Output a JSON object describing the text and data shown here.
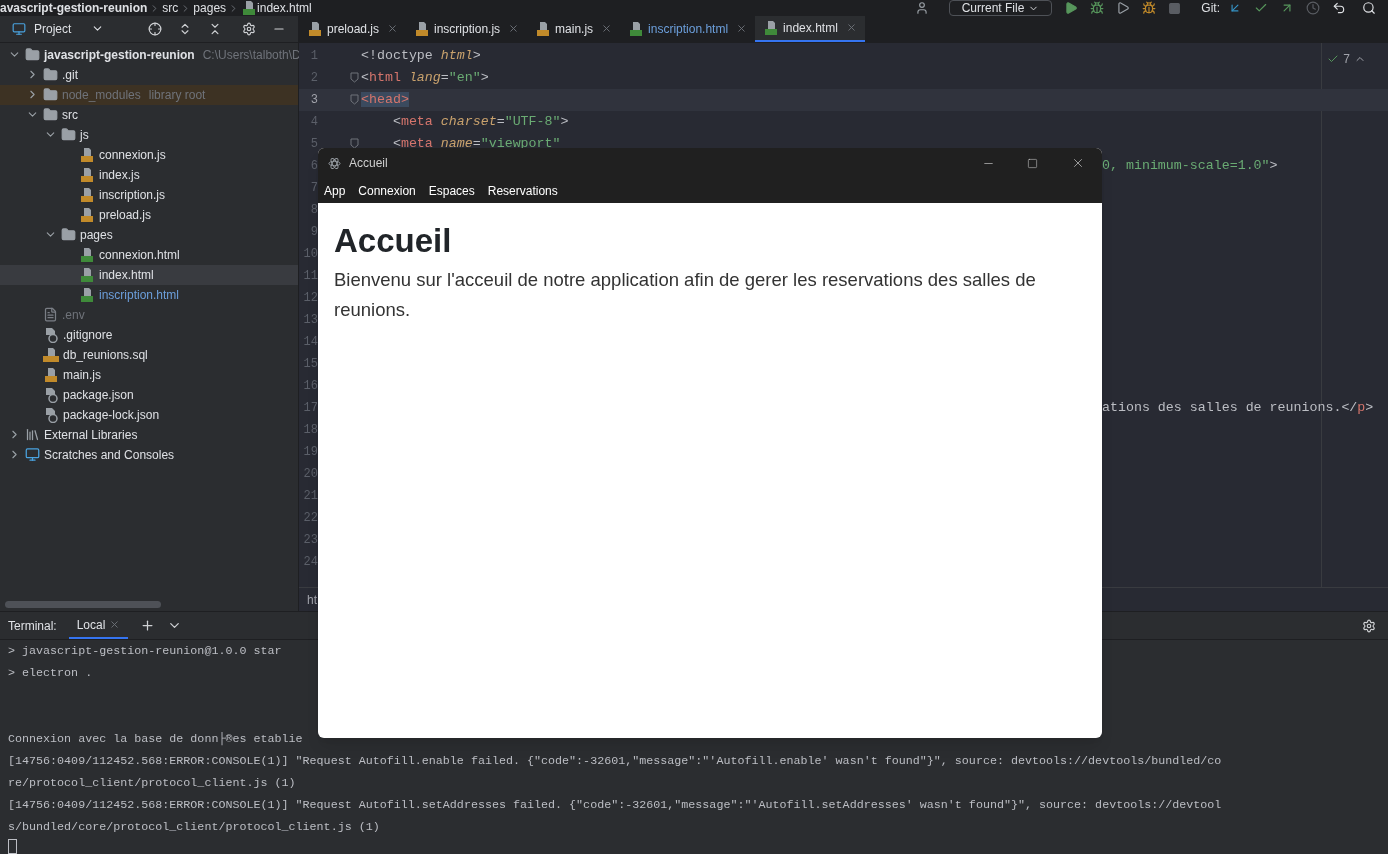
{
  "breadcrumb": [
    "avascript-gestion-reunion",
    "src",
    "pages",
    "index.html"
  ],
  "toolbar": {
    "run_config": "Current File",
    "git_label": "Git:"
  },
  "project_panel": {
    "title": "Project"
  },
  "tree": [
    {
      "label": "javascript-gestion-reunion",
      "hint": "C:\\Users\\talboth\\D",
      "kind": "folder",
      "expanded": true,
      "selected": false,
      "modified": false,
      "dimmed": false,
      "children": [
        {
          "label": ".git",
          "kind": "folder",
          "expanded": false,
          "selected": false,
          "modified": false,
          "dimmed": false,
          "excluded": false
        },
        {
          "label": "node_modules",
          "hint": "library root",
          "kind": "folder",
          "expanded": false,
          "selected": false,
          "modified": false,
          "dimmed": true,
          "excluded": true
        },
        {
          "label": "src",
          "kind": "folder",
          "expanded": true,
          "selected": false,
          "modified": false,
          "dimmed": false,
          "excluded": false,
          "children": [
            {
              "label": "js",
              "kind": "folder",
              "expanded": true,
              "selected": false,
              "modified": false,
              "dimmed": false,
              "children": [
                {
                  "label": "connexion.js",
                  "kind": "js",
                  "selected": false,
                  "modified": false,
                  "dimmed": false
                },
                {
                  "label": "index.js",
                  "kind": "js",
                  "selected": false,
                  "modified": false,
                  "dimmed": false
                },
                {
                  "label": "inscription.js",
                  "kind": "js",
                  "selected": false,
                  "modified": false,
                  "dimmed": false
                },
                {
                  "label": "preload.js",
                  "kind": "js",
                  "selected": false,
                  "modified": false,
                  "dimmed": false
                }
              ]
            },
            {
              "label": "pages",
              "kind": "folder",
              "expanded": true,
              "selected": false,
              "modified": false,
              "dimmed": false,
              "children": [
                {
                  "label": "connexion.html",
                  "kind": "html",
                  "selected": false,
                  "modified": false,
                  "dimmed": false
                },
                {
                  "label": "index.html",
                  "kind": "html",
                  "selected": true,
                  "modified": false,
                  "dimmed": false
                },
                {
                  "label": "inscription.html",
                  "kind": "html",
                  "selected": false,
                  "modified": true,
                  "dimmed": false
                }
              ]
            }
          ]
        },
        {
          "label": ".env",
          "kind": "text",
          "selected": false,
          "modified": false,
          "dimmed": true,
          "excluded": false
        },
        {
          "label": ".gitignore",
          "kind": "ignorefile",
          "selected": false,
          "modified": false,
          "dimmed": false,
          "excluded": false
        },
        {
          "label": "db_reunions.sql",
          "kind": "sql",
          "selected": false,
          "modified": false,
          "dimmed": false,
          "excluded": false
        },
        {
          "label": "main.js",
          "kind": "js",
          "selected": false,
          "modified": false,
          "dimmed": false,
          "excluded": false
        },
        {
          "label": "package.json",
          "kind": "json",
          "selected": false,
          "modified": false,
          "dimmed": false,
          "excluded": false
        },
        {
          "label": "package-lock.json",
          "kind": "json",
          "selected": false,
          "modified": false,
          "dimmed": false,
          "excluded": false
        }
      ]
    },
    {
      "label": "External Libraries",
      "kind": "libraries",
      "expanded": false,
      "selected": false,
      "modified": false,
      "dimmed": false
    },
    {
      "label": "Scratches and Consoles",
      "kind": "scratches",
      "expanded": false,
      "selected": false,
      "modified": false,
      "dimmed": false
    }
  ],
  "tabs": [
    {
      "label": "preload.js",
      "kind": "js",
      "selected": false,
      "modified": false
    },
    {
      "label": "inscription.js",
      "kind": "js",
      "selected": false,
      "modified": false
    },
    {
      "label": "main.js",
      "kind": "js",
      "selected": false,
      "modified": false
    },
    {
      "label": "inscription.html",
      "kind": "html",
      "selected": false,
      "modified": true
    },
    {
      "label": "index.html",
      "kind": "html",
      "selected": true,
      "modified": false
    }
  ],
  "editor": {
    "inspection_count": "7",
    "status_path": "ht",
    "lines": [
      {
        "number": "1",
        "fold": false,
        "current": false,
        "code": [
          {
            "text": "<!doctype ",
            "kind": "plain"
          },
          {
            "text": "html",
            "kind": "attr"
          },
          {
            "text": ">",
            "kind": "plain"
          }
        ]
      },
      {
        "number": "2",
        "fold": true,
        "current": false,
        "code": [
          {
            "text": "<",
            "kind": "plain"
          },
          {
            "text": "html",
            "kind": "tag"
          },
          {
            "text": " lang",
            "kind": "attr"
          },
          {
            "text": "=",
            "kind": "plain"
          },
          {
            "text": "\"en\"",
            "kind": "value"
          },
          {
            "text": ">",
            "kind": "plain"
          }
        ]
      },
      {
        "number": "3",
        "fold": true,
        "current": true,
        "code": [
          {
            "text": "<head>",
            "kind": "selected-tag"
          }
        ]
      },
      {
        "number": "4",
        "fold": false,
        "current": false,
        "code": [
          {
            "text": "    <",
            "kind": "plain"
          },
          {
            "text": "meta",
            "kind": "tag"
          },
          {
            "text": " charset",
            "kind": "attr"
          },
          {
            "text": "=",
            "kind": "plain"
          },
          {
            "text": "\"UTF-8\"",
            "kind": "value"
          },
          {
            "text": ">",
            "kind": "plain"
          }
        ]
      },
      {
        "number": "5",
        "fold": true,
        "current": false,
        "code": [
          {
            "text": "    <",
            "kind": "plain"
          },
          {
            "text": "meta",
            "kind": "tag"
          },
          {
            "text": " name",
            "kind": "attr"
          },
          {
            "text": "=",
            "kind": "plain"
          },
          {
            "text": "\"viewport\"",
            "kind": "value"
          }
        ]
      },
      {
        "number": "6",
        "fold": false,
        "current": false,
        "tail": [
          {
            "text": "0, minimum-scale=1.0\"",
            "kind": "value"
          },
          {
            "text": ">",
            "kind": "plain"
          }
        ]
      },
      {
        "number": "7",
        "fold": false,
        "current": false
      },
      {
        "number": "8",
        "fold": false,
        "current": false
      },
      {
        "number": "9",
        "fold": false,
        "current": false
      },
      {
        "number": "10",
        "fold": false,
        "current": false
      },
      {
        "number": "11",
        "fold": false,
        "current": false
      },
      {
        "number": "12",
        "fold": false,
        "current": false
      },
      {
        "number": "13",
        "fold": false,
        "current": false
      },
      {
        "number": "14",
        "fold": false,
        "current": false
      },
      {
        "number": "15",
        "fold": false,
        "current": false
      },
      {
        "number": "16",
        "fold": false,
        "current": false
      },
      {
        "number": "17",
        "fold": false,
        "current": false,
        "tail": [
          {
            "text": "ations des salles de reunions.</",
            "kind": "plain"
          },
          {
            "text": "p",
            "kind": "tag"
          },
          {
            "text": ">",
            "kind": "plain"
          }
        ]
      },
      {
        "number": "18",
        "fold": false,
        "current": false
      },
      {
        "number": "19",
        "fold": false,
        "current": false
      },
      {
        "number": "20",
        "fold": false,
        "current": false
      },
      {
        "number": "21",
        "fold": false,
        "current": false
      },
      {
        "number": "22",
        "fold": false,
        "current": false
      },
      {
        "number": "23",
        "fold": false,
        "current": false
      },
      {
        "number": "24",
        "fold": false,
        "current": false
      }
    ]
  },
  "terminal": {
    "title": "Terminal:",
    "tabs": [
      {
        "label": "Local",
        "selected": true
      }
    ],
    "blocks": [
      [
        "> javascript-gestion-reunion@1.0.0 star",
        "> electron ."
      ],
      [
        "Connexion avec la base de donn├®es etablie",
        "[14756:0409/112452.568:ERROR:CONSOLE(1)] \"Request Autofill.enable failed. {\"code\":-32601,\"message\":\"'Autofill.enable' wasn't found\"}\", source: devtools://devtools/bundled/co",
        "re/protocol_client/protocol_client.js (1)",
        "[14756:0409/112452.568:ERROR:CONSOLE(1)] \"Request Autofill.setAddresses failed. {\"code\":-32601,\"message\":\"'Autofill.setAddresses' wasn't found\"}\", source: devtools://devtool",
        "s/bundled/core/protocol_client/protocol_client.js (1)"
      ]
    ]
  },
  "app_window": {
    "title": "Accueil",
    "menu": [
      "App",
      "Connexion",
      "Espaces",
      "Reservations"
    ],
    "heading": "Accueil",
    "text": "Bienvenu sur l'acceuil de notre application afin de gerer les reservations des salles de reunions."
  }
}
